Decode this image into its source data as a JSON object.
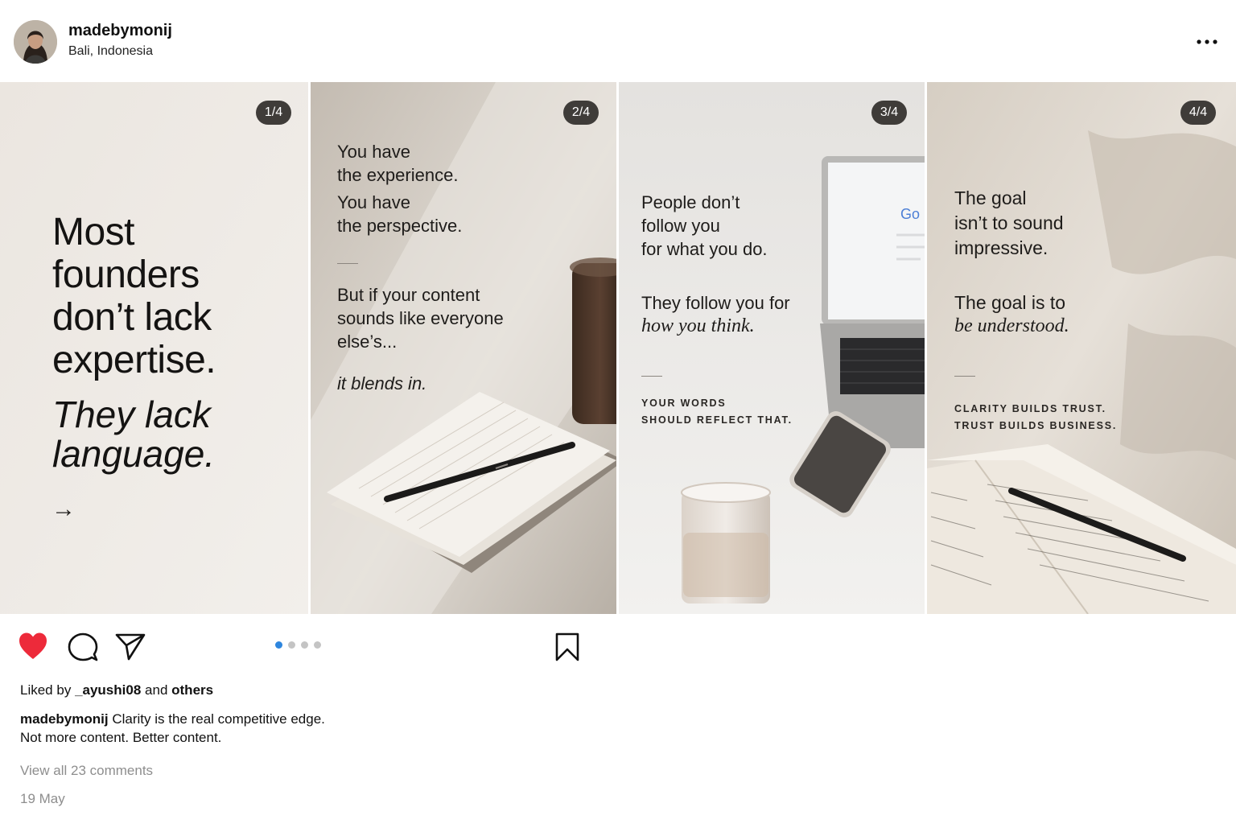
{
  "header": {
    "username": "madebymonij",
    "location": "Bali, Indonesia"
  },
  "slides": [
    {
      "counter": "1/4",
      "lines": [
        "Most",
        "founders",
        "don’t lack",
        "expertise."
      ],
      "italic_lines": [
        "They lack",
        "language."
      ],
      "arrow": "→"
    },
    {
      "counter": "2/4",
      "block1": [
        "You have",
        "the experience."
      ],
      "block2": [
        "You have",
        "the perspective."
      ],
      "block3": [
        "But if your content",
        "sounds like everyone",
        "else’s..."
      ],
      "italic": "it blends in."
    },
    {
      "counter": "3/4",
      "block1": [
        "People don’t",
        "follow you",
        "for what you do."
      ],
      "block2": "They follow you for",
      "italic": "how you think.",
      "caps": [
        "YOUR WORDS",
        "SHOULD REFLECT THAT."
      ]
    },
    {
      "counter": "4/4",
      "block1": [
        "The goal",
        "isn’t to sound",
        "impressive."
      ],
      "block2": "The goal is to",
      "italic": "be understood.",
      "caps": [
        "CLARITY BUILDS TRUST.",
        "TRUST BUILDS BUSINESS."
      ]
    }
  ],
  "actions": {
    "like_icon": "heart-filled-icon",
    "comment_icon": "comment-icon",
    "share_icon": "send-icon",
    "save_icon": "bookmark-icon",
    "like_color": "#ed2a3a",
    "active_dot_color": "#2e86de",
    "page_count": 4,
    "active_page": 1
  },
  "likes": {
    "prefix": "Liked by",
    "user": "_ayushi08",
    "middle": "and",
    "others": "others"
  },
  "caption": {
    "username": "madebymonij",
    "line1": "Clarity is the real competitive edge.",
    "line2": "Not more content. Better content."
  },
  "comments_link": "View all 23 comments",
  "date": "19 May"
}
